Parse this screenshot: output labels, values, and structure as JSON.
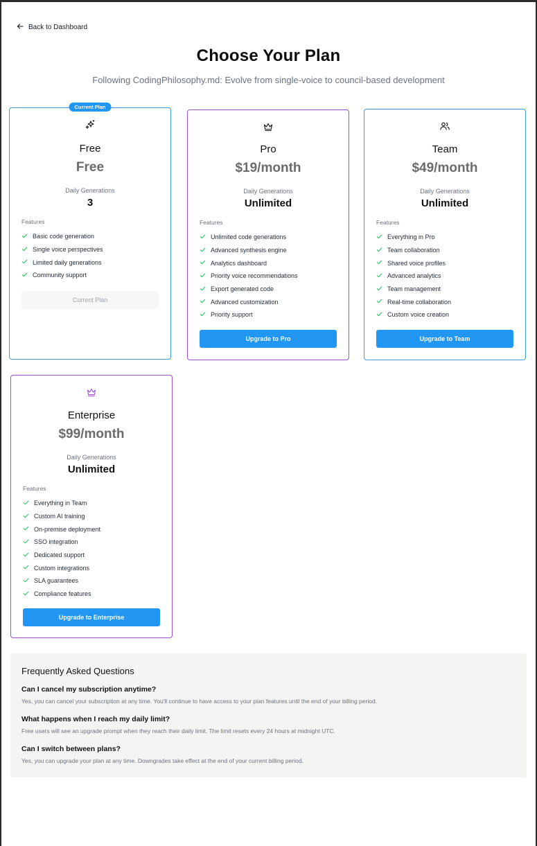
{
  "nav": {
    "back_label": "Back to Dashboard"
  },
  "header": {
    "title": "Choose Your Plan",
    "subtitle": "Following CodingPhilosophy.md: Evolve from single-voice to council-based development"
  },
  "plans": [
    {
      "badge": "Current Plan",
      "icon": "sparkles-icon",
      "name": "Free",
      "price": "Free",
      "generations_label": "Daily Generations",
      "generations_value": "3",
      "features_label": "Features",
      "features": [
        "Basic code generation",
        "Single voice perspectives",
        "Limited daily generations",
        "Community support"
      ],
      "button_label": "Current Plan",
      "button_state": "disabled"
    },
    {
      "icon": "crown-icon",
      "name": "Pro",
      "price": "$19/month",
      "generations_label": "Daily Generations",
      "generations_value": "Unlimited",
      "features_label": "Features",
      "features": [
        "Unlimited code generations",
        "Advanced synthesis engine",
        "Analytics dashboard",
        "Priority voice recommendations",
        "Export generated code",
        "Advanced customization",
        "Priority support"
      ],
      "button_label": "Upgrade to Pro",
      "button_state": "primary"
    },
    {
      "icon": "users-icon",
      "name": "Team",
      "price": "$49/month",
      "generations_label": "Daily Generations",
      "generations_value": "Unlimited",
      "features_label": "Features",
      "features": [
        "Everything in Pro",
        "Team collaboration",
        "Shared voice profiles",
        "Advanced analytics",
        "Team management",
        "Real-time collaboration",
        "Custom voice creation"
      ],
      "button_label": "Upgrade to Team",
      "button_state": "primary"
    },
    {
      "icon": "crown-icon",
      "name": "Enterprise",
      "price": "$99/month",
      "generations_label": "Daily Generations",
      "generations_value": "Unlimited",
      "features_label": "Features",
      "features": [
        "Everything in Team",
        "Custom AI training",
        "On-premise deployment",
        "SSO integration",
        "Dedicated support",
        "Custom integrations",
        "SLA guarantees",
        "Compliance features"
      ],
      "button_label": "Upgrade to Enterprise",
      "button_state": "primary"
    }
  ],
  "faq": {
    "title": "Frequently Asked Questions",
    "items": [
      {
        "q": "Can I cancel my subscription anytime?",
        "a": "Yes, you can cancel your subscription at any time. You'll continue to have access to your plan features until the end of your billing period."
      },
      {
        "q": "What happens when I reach my daily limit?",
        "a": "Free users will see an upgrade prompt when they reach their daily limit. The limit resets every 24 hours at midnight UTC."
      },
      {
        "q": "Can I switch between plans?",
        "a": "Yes, you can upgrade your plan at any time. Downgrades take effect at the end of your current billing period."
      }
    ]
  },
  "colors": {
    "accent_blue": "#2196f3",
    "card_border_blue": "#3b9be8",
    "card_border_purple": "#9b4fd6",
    "check_green": "#22c55e",
    "faq_background": "#f4f4f3"
  }
}
